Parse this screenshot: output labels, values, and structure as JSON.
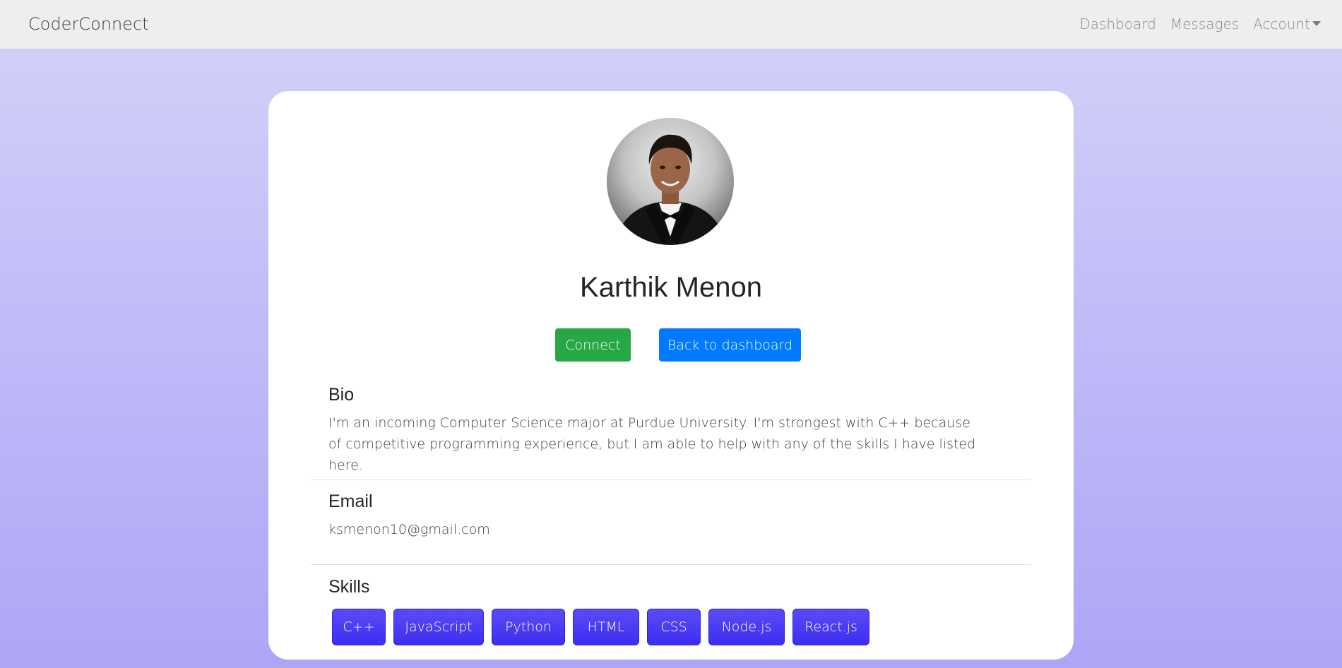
{
  "nav": {
    "brand": "CoderConnect",
    "links": [
      "Dashboard",
      "Messages",
      "Account"
    ]
  },
  "profile": {
    "name": "Karthik Menon",
    "connect_label": "Connect",
    "back_label": "Back to dashboard",
    "bio_title": "Bio",
    "bio_text": "I'm an incoming Computer Science major at Purdue University. I'm strongest with C++ because of competitive programming experience, but I am able to help with any of the skills I have listed here.",
    "email_title": "Email",
    "email": "ksmenon10@gmail.com",
    "skills_title": "Skills",
    "skills": [
      "C++",
      "JavaScript",
      "Python",
      "HTML",
      "CSS",
      "Node.js",
      "React.js"
    ]
  },
  "colors": {
    "connect": "#28a745",
    "back": "#007bff",
    "skill": "#4a3cf4"
  }
}
